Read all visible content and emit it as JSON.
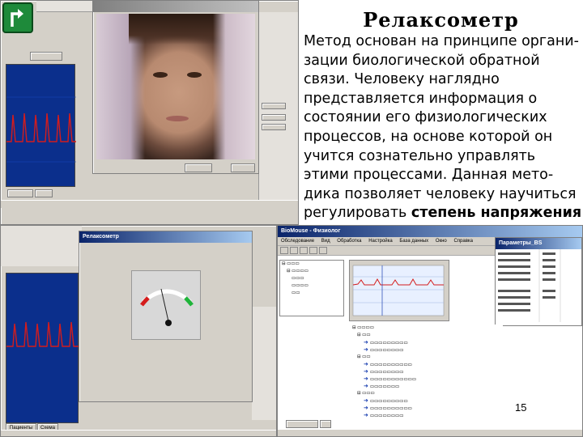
{
  "slide": {
    "title": "Релаксометр",
    "lines": [
      "Метод основан на принципе органи-",
      "зации биологической обратной",
      "связи. Человеку наглядно",
      "представляется информация о",
      "состоянии его физиологических",
      "процессов, на основе которой он",
      "учится сознательно управлять",
      "этими процессами. Данная мето-",
      "дика позволяет человеку научиться"
    ],
    "last_line_prefix": "регулировать ",
    "last_line_bold": "степень напряжения",
    "page_number": "15"
  },
  "relax_window": {
    "title": "Релаксометр"
  },
  "bio_window": {
    "title": "BioMouse - Физиолог",
    "menu": [
      "Обследование",
      "Вид",
      "Обработка",
      "Настройка",
      "База данных",
      "Окно",
      "Справка"
    ],
    "params_title": "Параметры_BS"
  },
  "taskbar": {
    "tab1": "Пациенты",
    "tab2": "Схема"
  },
  "colors": {
    "graph_bg": "#0b2f8c",
    "signal": "#d41c1c",
    "home_button": "#1e8a3a"
  },
  "icons": [
    "home-return-icon",
    "arrow-right-icon",
    "gauge-icon"
  ]
}
